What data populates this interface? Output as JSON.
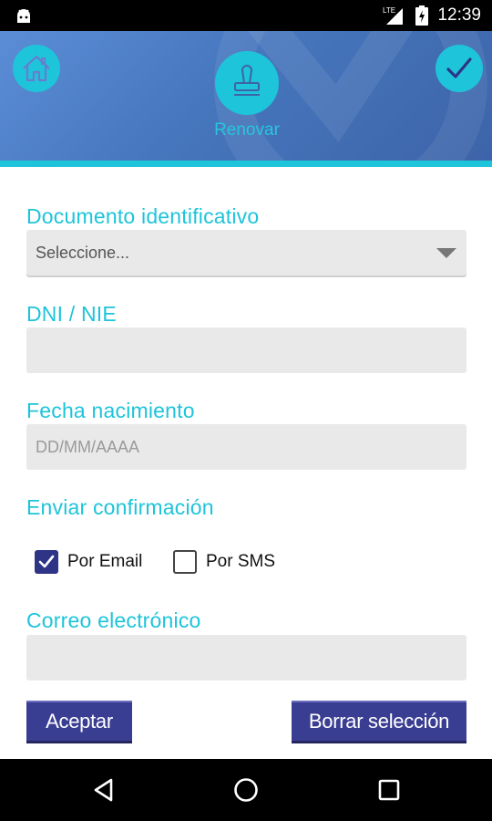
{
  "status_bar": {
    "time": "12:39",
    "network": "LTE",
    "icons": [
      "android-icon",
      "signal-icon",
      "battery-icon"
    ]
  },
  "header": {
    "home_icon": "home-icon",
    "action_icon": "stamp-icon",
    "action_label": "Renovar",
    "confirm_icon": "check-icon",
    "colors": {
      "header_gradient_start": "#5b8dd6",
      "header_gradient_end": "#3d64a9",
      "accent": "#1ec4da"
    }
  },
  "form": {
    "document_label": "Documento identificativo",
    "document_select": {
      "value": "Seleccione..."
    },
    "dni_label": "DNI / NIE",
    "dni_value": "",
    "birth_label": "Fecha nacimiento",
    "birth_placeholder": "DD/MM/AAAA",
    "confirmation_label": "Enviar confirmación",
    "options": {
      "email": {
        "label": "Por Email",
        "checked": true
      },
      "sms": {
        "label": "Por SMS",
        "checked": false
      }
    },
    "email_label": "Correo electrónico",
    "email_value": ""
  },
  "buttons": {
    "accept": "Aceptar",
    "clear": "Borrar selección",
    "color": "#3a3e93"
  },
  "nav_bar": {
    "icons": [
      "back-icon",
      "home-circle-icon",
      "recents-icon"
    ]
  }
}
